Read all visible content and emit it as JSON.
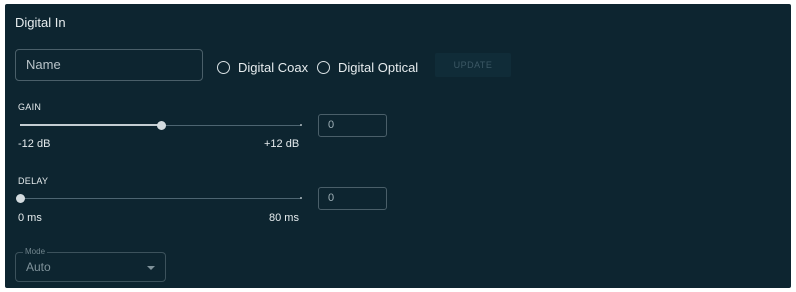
{
  "panel": {
    "title": "Digital In"
  },
  "name_field": {
    "placeholder": "Name"
  },
  "source": {
    "options": [
      {
        "label": "Digital Coax",
        "selected": false
      },
      {
        "label": "Digital Optical",
        "selected": false
      }
    ]
  },
  "update_label": "UPDATE",
  "gain": {
    "label": "GAIN",
    "min_label": "-12 dB",
    "max_label": "+12 dB",
    "value": "0",
    "position_fraction": 0.5
  },
  "delay": {
    "label": "DELAY",
    "min_label": "0 ms",
    "max_label": "80 ms",
    "value": "0",
    "position_fraction": 0
  },
  "mode": {
    "label": "Mode",
    "value": "Auto"
  },
  "icons": {
    "dropdown": "chevron-down-icon",
    "radio": "radio-unchecked-icon"
  }
}
